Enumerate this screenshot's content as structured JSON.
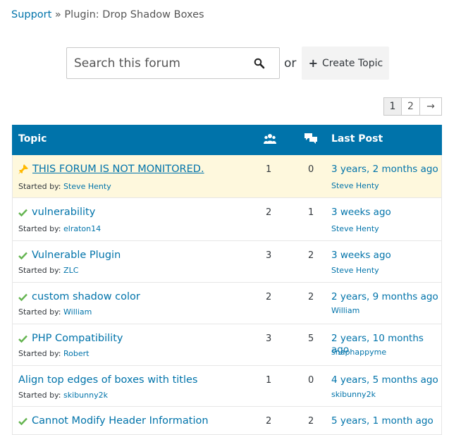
{
  "breadcrumb": {
    "root": "Support",
    "separator": " » ",
    "current": "Plugin: Drop Shadow Boxes"
  },
  "search": {
    "placeholder": "Search this forum",
    "or": "or",
    "create_label": "Create Topic"
  },
  "pagination": {
    "pages": [
      "1",
      "2"
    ],
    "next": "→",
    "current": "1"
  },
  "table": {
    "headers": {
      "topic": "Topic",
      "last_post": "Last Post"
    },
    "rows": [
      {
        "title": "THIS FORUM IS NOT MONITORED.",
        "started_label": "Started by:",
        "author": "Steve Henty",
        "voices": "1",
        "posts": "0",
        "freshness": "3 years, 2 months ago",
        "last_by": "Steve Henty",
        "icon": "pin"
      },
      {
        "title": "vulnerability",
        "started_label": "Started by:",
        "author": "elraton14",
        "voices": "2",
        "posts": "1",
        "freshness": "3 weeks ago",
        "last_by": "Steve Henty",
        "icon": "check"
      },
      {
        "title": "Vulnerable Plugin",
        "started_label": "Started by:",
        "author": "ZLC",
        "voices": "3",
        "posts": "2",
        "freshness": "3 weeks ago",
        "last_by": "Steve Henty",
        "icon": "check"
      },
      {
        "title": "custom shadow color",
        "started_label": "Started by:",
        "author": "William",
        "voices": "2",
        "posts": "2",
        "freshness": "2 years, 9 months ago",
        "last_by": "William",
        "icon": "check"
      },
      {
        "title": "PHP Compatibility",
        "started_label": "Started by:",
        "author": "Robert",
        "voices": "3",
        "posts": "5",
        "freshness": "2 years, 10 months ago",
        "last_by": "snaphappyme",
        "icon": "check"
      },
      {
        "title": "Align top edges of boxes with titles",
        "started_label": "Started by:",
        "author": "skibunny2k",
        "voices": "1",
        "posts": "0",
        "freshness": "4 years, 5 months ago",
        "last_by": "skibunny2k",
        "icon": ""
      },
      {
        "title": "Cannot Modify Header Information",
        "started_label": "",
        "author": "",
        "voices": "2",
        "posts": "2",
        "freshness": "5 years, 1 month ago",
        "last_by": "",
        "icon": "check"
      }
    ]
  },
  "colors": {
    "link": "#0073aa",
    "header_bg": "#0073aa",
    "sticky_bg": "#fef8dd",
    "check": "#64b450",
    "pin": "#ffb900"
  },
  "icons": {
    "search": "search-icon",
    "plus": "plus-icon",
    "voices": "users-icon",
    "posts": "speech-bubbles-icon",
    "pin": "pin-icon",
    "check": "checkmark-icon"
  }
}
